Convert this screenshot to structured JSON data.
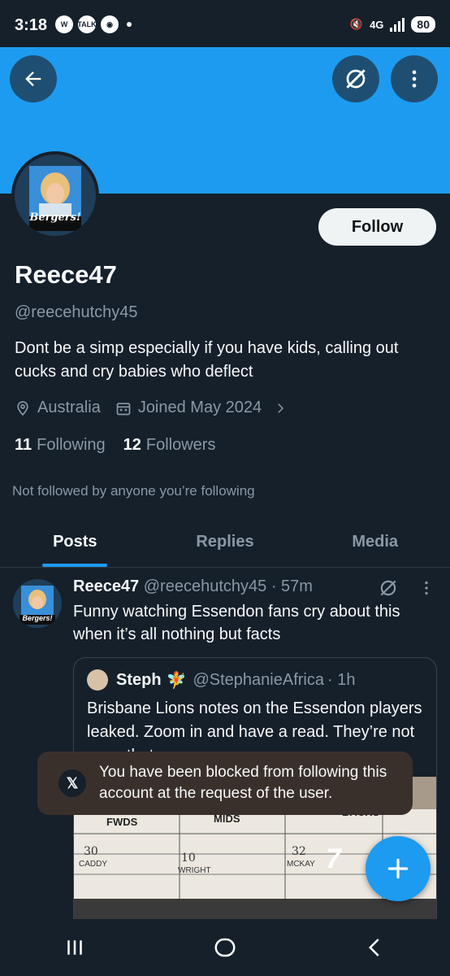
{
  "status_bar": {
    "time": "3:18",
    "left_icons": [
      "wordpress-icon",
      "talk-icon",
      "discord-icon"
    ],
    "network": "4G",
    "battery": "80"
  },
  "profile": {
    "display_name": "Reece47",
    "handle": "@reecehutchy45",
    "bio": "Dont be a simp especially if you have kids, calling out cucks and cry babies who deflect",
    "location": "Australia",
    "joined": "Joined May 2024",
    "following_count": "11",
    "following_label": "Following",
    "followers_count": "12",
    "followers_label": "Followers",
    "not_followed_text": "Not followed by anyone you’re following",
    "avatar_caption": "Bergers!"
  },
  "actions": {
    "follow_label": "Follow"
  },
  "tabs": [
    {
      "label": "Posts",
      "active": true
    },
    {
      "label": "Replies",
      "active": false
    },
    {
      "label": "Media",
      "active": false
    }
  ],
  "post": {
    "author": "Reece47",
    "handle": "@reecehutchy45",
    "time": "· 57m",
    "text": "Funny watching Essendon fans cry about this when it’s all nothing but facts",
    "avatar_caption": "Bergers!",
    "quote": {
      "author": "Steph",
      "emoji": "🧚",
      "handle": "@StephanieAfrica",
      "time": "· 1h",
      "text": "Brisbane Lions notes on the Essendon players leaked. Zoom in and have a read. They’re not even that",
      "image_labels": [
        "FWDS",
        "MIDS",
        "BACKS"
      ],
      "image_numbers": [
        "30",
        "10",
        "32"
      ],
      "image_names": [
        "CADDY",
        "WRIGHT",
        "MCKAY"
      ],
      "image_count": "3"
    }
  },
  "toast": {
    "message": "You have been blocked from following this account at the request of the user."
  },
  "colors": {
    "background": "#15202b",
    "banner": "#1d9bf0",
    "accent": "#1d9bf0",
    "muted_text": "#8b98a5",
    "toast_bg": "#3a302b"
  }
}
